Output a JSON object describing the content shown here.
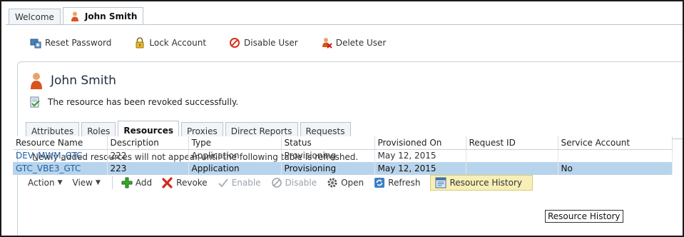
{
  "top_tabs": [
    {
      "label": "Welcome",
      "active": false
    },
    {
      "label": "John Smith",
      "active": true
    }
  ],
  "toolbar": {
    "reset_password": "Reset Password",
    "lock_account": "Lock Account",
    "disable_user": "Disable User",
    "delete_user": "Delete User"
  },
  "user": {
    "name": "John Smith",
    "message": "The resource has been revoked successfully."
  },
  "sub_tabs": [
    "Attributes",
    "Roles",
    "Resources",
    "Proxies",
    "Direct Reports",
    "Requests"
  ],
  "active_sub_tab": "Resources",
  "note": "Newly added resources will not appear until the following table is refreshed.",
  "actions": {
    "action": "Action",
    "view": "View",
    "add": "Add",
    "revoke": "Revoke",
    "enable": "Enable",
    "disable": "Disable",
    "open": "Open",
    "refresh": "Refresh",
    "resource_history": "Resource History"
  },
  "table": {
    "columns": [
      "Resource Name",
      "Description",
      "Type",
      "Status",
      "Provisioned On",
      "Request ID",
      "Service Account"
    ],
    "rows": [
      {
        "name": "DEV_MWM_GTC",
        "description": "222",
        "type": "Application",
        "status": "Provisioning",
        "provisioned_on": "May 12, 2015",
        "request_id": "",
        "service_account": ""
      },
      {
        "name": "GTC_VBE3_GTC",
        "description": "223",
        "type": "Application",
        "status": "Provisioning",
        "provisioned_on": "May 12, 2015",
        "request_id": "",
        "service_account": "No"
      }
    ]
  },
  "tooltip": "Resource History",
  "colors": {
    "link": "#1f5fa8",
    "selected_row": "#b8d4ec",
    "highlight": "#f7efb6"
  }
}
